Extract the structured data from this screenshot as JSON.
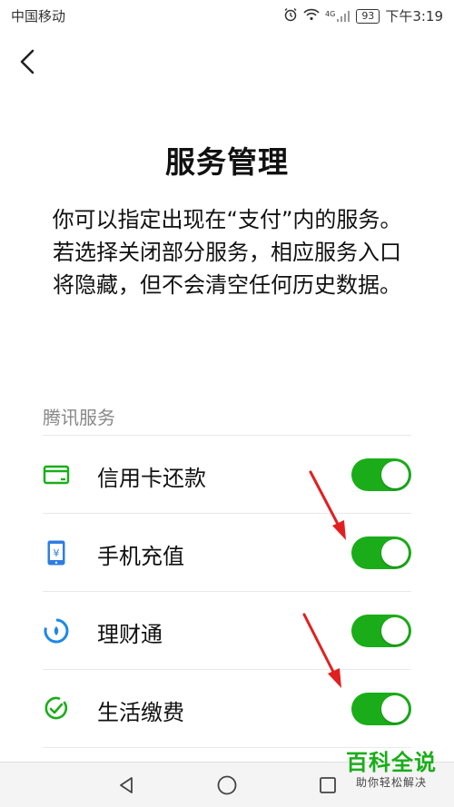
{
  "status_bar": {
    "carrier": "中国移动",
    "network": "4G",
    "battery": "93",
    "time": "下午3:19"
  },
  "page": {
    "title": "服务管理",
    "description": "你可以指定出现在“支付”内的服务。若选择关闭部分服务，相应服务入口将隐藏，但不会清空任何历史数据。"
  },
  "section": {
    "title": "腾讯服务",
    "items": [
      {
        "label": "信用卡还款",
        "icon": "credit-card-icon",
        "enabled": true
      },
      {
        "label": "手机充值",
        "icon": "phone-topup-icon",
        "enabled": true
      },
      {
        "label": "理财通",
        "icon": "licaitong-icon",
        "enabled": true
      },
      {
        "label": "生活缴费",
        "icon": "life-payment-icon",
        "enabled": true
      }
    ]
  },
  "colors": {
    "accent": "#1aad19",
    "arrow": "#e02020"
  },
  "watermark": {
    "main": "百科全说",
    "sub": "助你轻松解决"
  }
}
